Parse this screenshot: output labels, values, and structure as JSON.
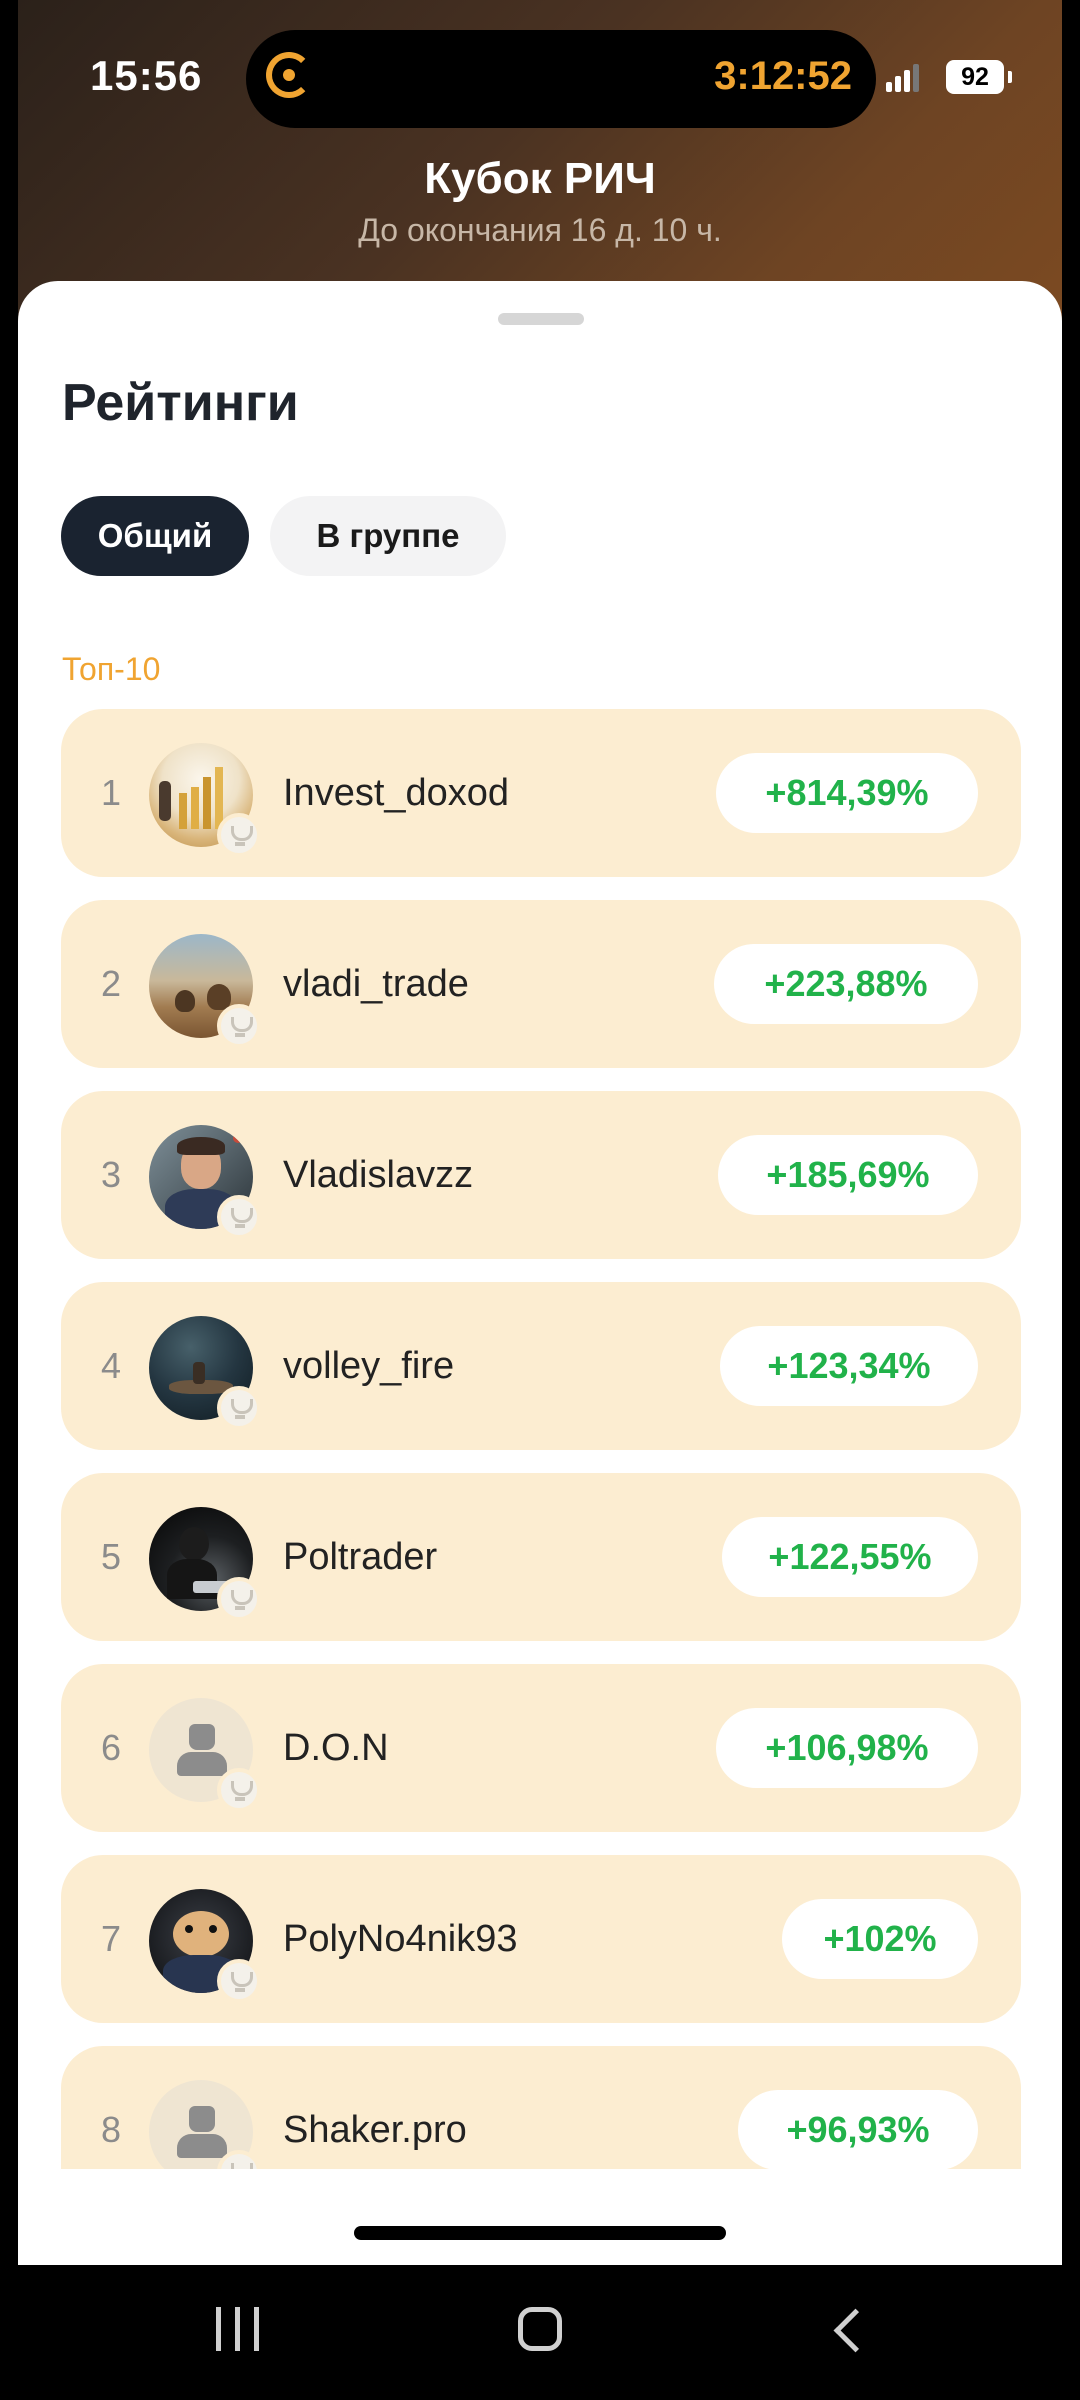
{
  "status_bar": {
    "time": "15:56",
    "activity_timer": "3:12:52",
    "battery_level": "92",
    "accent_color": "#f0a431"
  },
  "header": {
    "title": "Кубок РИЧ",
    "subtitle": "До окончания 16 д. 10 ч."
  },
  "sheet": {
    "title": "Рейтинги",
    "tabs": [
      {
        "label": "Общий",
        "selected": true
      },
      {
        "label": "В группе",
        "selected": false
      }
    ],
    "section_label": "Топ-10"
  },
  "leaderboard": [
    {
      "rank": "1",
      "username": "Invest_doxod",
      "return": "+814,39%",
      "avatar": "photo"
    },
    {
      "rank": "2",
      "username": "vladi_trade",
      "return": "+223,88%",
      "avatar": "photo"
    },
    {
      "rank": "3",
      "username": "Vladislavzz",
      "return": "+185,69%",
      "avatar": "photo"
    },
    {
      "rank": "4",
      "username": "volley_fire",
      "return": "+123,34%",
      "avatar": "photo"
    },
    {
      "rank": "5",
      "username": "Poltrader",
      "return": "+122,55%",
      "avatar": "photo"
    },
    {
      "rank": "6",
      "username": "D.O.N",
      "return": "+106,98%",
      "avatar": "default-user-icon"
    },
    {
      "rank": "7",
      "username": "PolyNo4nik93",
      "return": "+102%",
      "avatar": "photo"
    },
    {
      "rank": "8",
      "username": "Shaker.pro",
      "return": "+96,93%",
      "avatar": "default-user-icon"
    }
  ],
  "colors": {
    "row_background": "#fcedd1",
    "positive_return": "#21b24a",
    "selected_tab": "#1a2330"
  },
  "nav_icons": [
    "recent-apps-icon",
    "home-icon",
    "back-icon"
  ]
}
